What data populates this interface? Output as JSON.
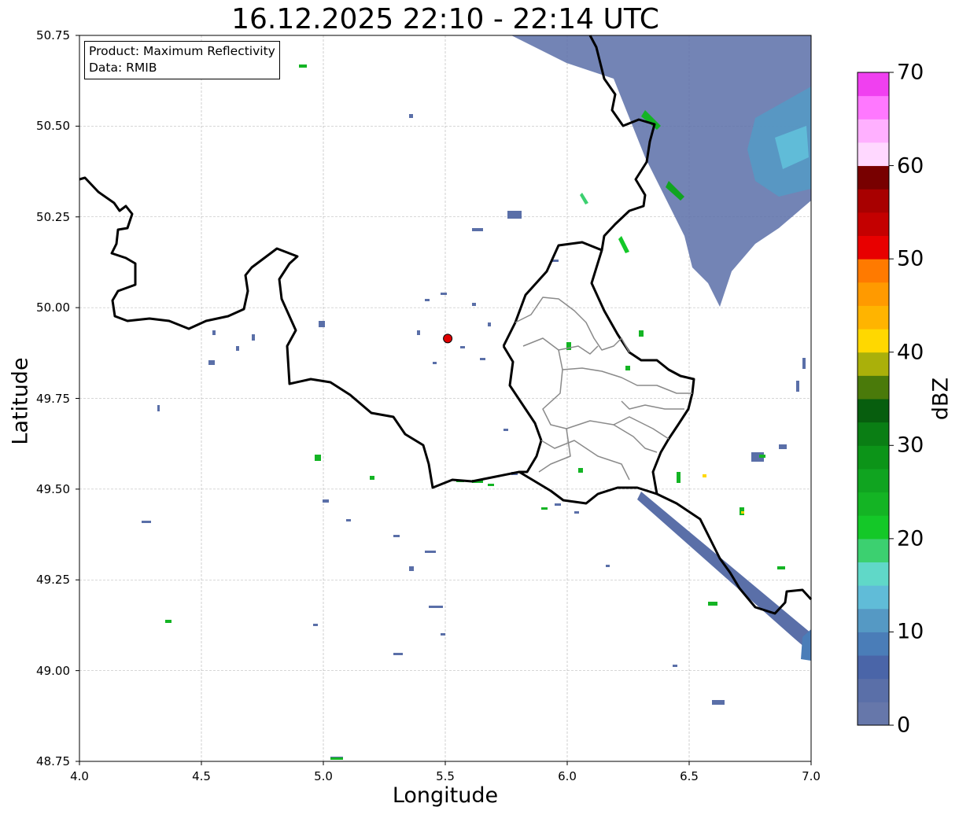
{
  "title": "16.12.2025 22:10 - 22:14 UTC",
  "info_box": {
    "product": "Product: Maximum Reflectivity",
    "data": "Data: RMIB"
  },
  "axes": {
    "xlabel": "Longitude",
    "ylabel": "Latitude",
    "xlim": [
      4.0,
      7.0
    ],
    "ylim": [
      48.75,
      50.75
    ],
    "xticks": [
      "4.0",
      "4.5",
      "5.0",
      "5.5",
      "6.0",
      "6.5",
      "7.0"
    ],
    "yticks": [
      "48.75",
      "49.00",
      "49.25",
      "49.50",
      "49.75",
      "50.00",
      "50.25",
      "50.50",
      "50.75"
    ],
    "grid": true
  },
  "radar_site": {
    "lon": 5.51,
    "lat": 49.915,
    "color": "#e00000"
  },
  "colorbar": {
    "label": "dBZ",
    "min": 0,
    "max": 70,
    "ticks": [
      "0",
      "10",
      "20",
      "30",
      "40",
      "50",
      "60",
      "70"
    ],
    "colors": [
      "#6677aa",
      "#5a6fa8",
      "#4a65a8",
      "#4a7db8",
      "#5599c4",
      "#60bcd8",
      "#60d8c8",
      "#3cd070",
      "#14c828",
      "#14b424",
      "#10a420",
      "#0c9418",
      "#0a7e14",
      "#075e0e",
      "#4a7a0a",
      "#aab00a",
      "#ffd800",
      "#ffb400",
      "#ff9a00",
      "#ff7a00",
      "#e80000",
      "#c40000",
      "#a80000",
      "#780000",
      "#ffd8ff",
      "#ffb0ff",
      "#ff78ff",
      "#f040f0"
    ]
  }
}
